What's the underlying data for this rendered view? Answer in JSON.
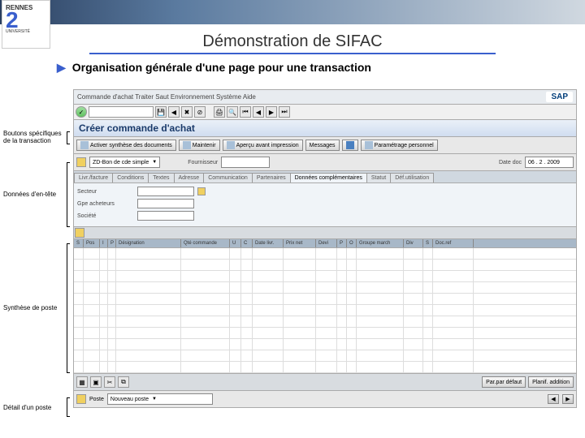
{
  "slide": {
    "title": "Démonstration de SIFAC",
    "subtitle": "Organisation générale d'une page pour une transaction"
  },
  "annotations": {
    "buttons": "Boutons spécifiques de la transaction",
    "header_data": "Données d'en-tête",
    "synthesis": "Synthèse de poste",
    "detail": "Détail d'un poste"
  },
  "sap": {
    "menu": "Commande d'achat  Traiter  Saut  Environnement  Système  Aide",
    "logo": "SAP",
    "title": "Créer commande d'achat",
    "buttons": {
      "b1": "Activer synthèse des documents",
      "b2": "Maintenir",
      "b3": "Aperçu avant impression",
      "b4": "Messages",
      "b5": "Paramétrage personnel"
    },
    "doc_type": "ZD-Bon de cde simple",
    "field_vendor_label": "Fournisseur",
    "field_date_label": "Date doc",
    "field_date_value": "06 . 2 . 2009",
    "tabs": [
      "Livr./facture",
      "Conditions",
      "Textes",
      "Adresse",
      "Communication",
      "Partenaires",
      "Données complémentaires",
      "Statut",
      "Déf.utilisation"
    ],
    "active_tab": 6,
    "header_fields": {
      "r1": "Secteur",
      "r2": "Gpe acheteurs",
      "r3": "Société"
    },
    "grid_cols": [
      "S",
      "Pos",
      "I",
      "P",
      "Désignation",
      "Qté commande",
      "U",
      "C",
      "Date livr.",
      "Prix net",
      "Devi",
      "P",
      "O",
      "Groupe march",
      "Div",
      "S",
      "Doc.ref"
    ],
    "grid_col_widths": [
      12,
      20,
      10,
      10,
      80,
      60,
      14,
      14,
      38,
      40,
      26,
      12,
      12,
      58,
      24,
      12,
      50
    ],
    "detail_buttons": {
      "left": "Par.par défaut",
      "right": "Planif. addition"
    },
    "detail_label": "Poste",
    "detail_value": "Nouveau poste"
  }
}
